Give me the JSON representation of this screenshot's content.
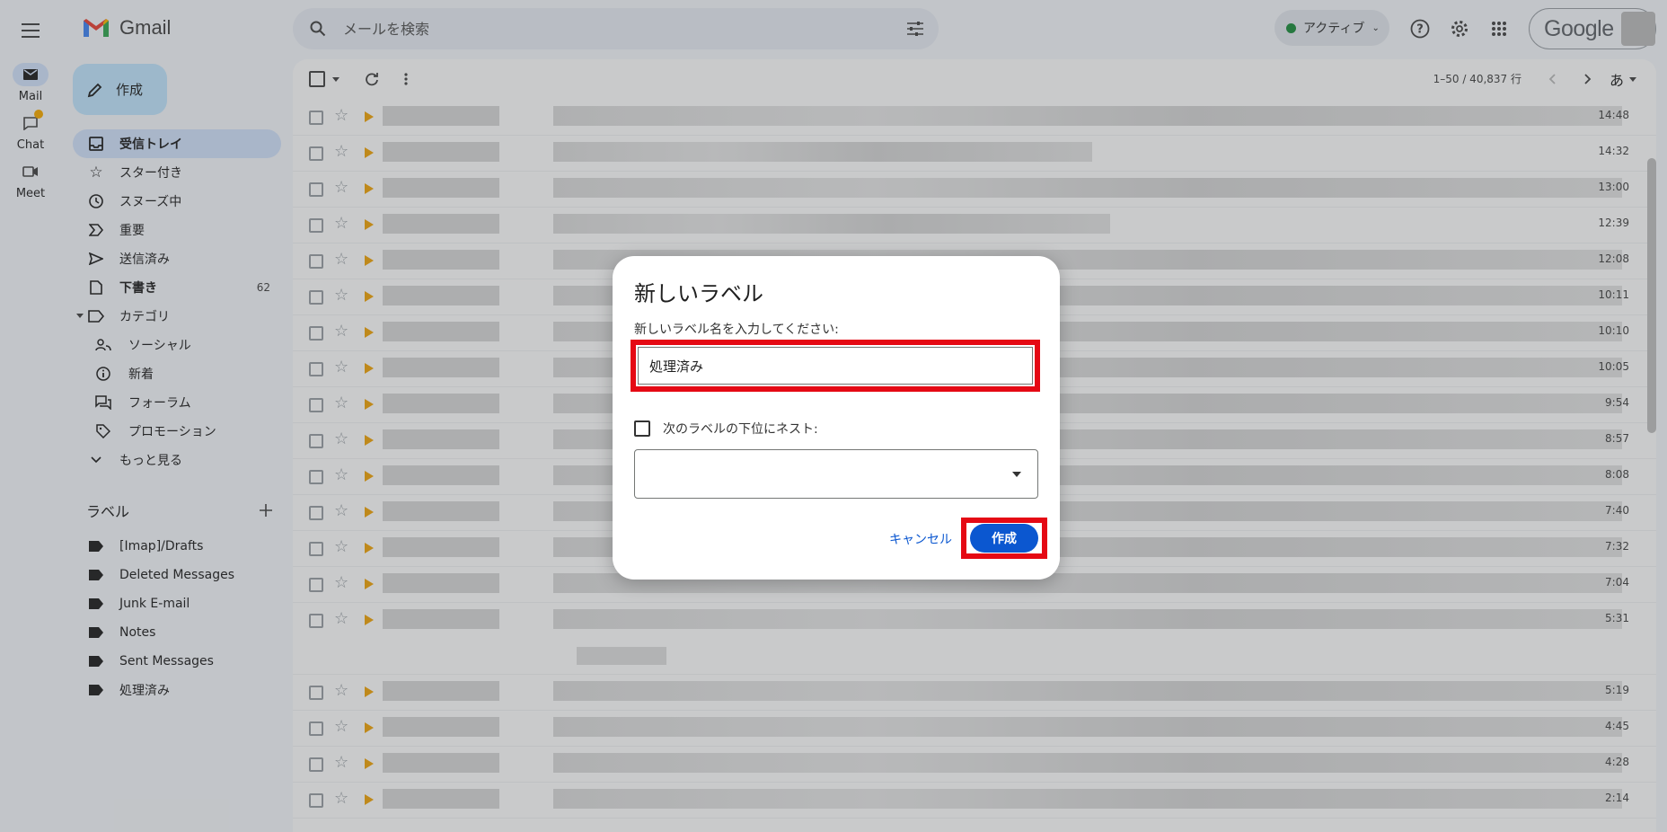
{
  "app": {
    "name": "Gmail"
  },
  "rail": [
    {
      "label": "Mail",
      "icon": "mail-icon",
      "active": true
    },
    {
      "label": "Chat",
      "icon": "chat-icon"
    },
    {
      "label": "Meet",
      "icon": "meet-icon"
    }
  ],
  "search": {
    "placeholder": "メールを検索"
  },
  "status": {
    "label": "アクティブ"
  },
  "account": {
    "brand": "Google"
  },
  "compose": {
    "label": "作成"
  },
  "nav": [
    {
      "label": "受信トレイ",
      "icon": "inbox-icon",
      "active": true
    },
    {
      "label": "スター付き",
      "icon": "star-icon"
    },
    {
      "label": "スヌーズ中",
      "icon": "clock-icon"
    },
    {
      "label": "重要",
      "icon": "important-icon"
    },
    {
      "label": "送信済み",
      "icon": "send-icon"
    },
    {
      "label": "下書き",
      "icon": "draft-icon",
      "count": "62"
    },
    {
      "label": "カテゴリ",
      "icon": "category-icon"
    },
    {
      "label": "ソーシャル",
      "icon": "people-icon",
      "sub": true
    },
    {
      "label": "新着",
      "icon": "info-icon",
      "sub": true
    },
    {
      "label": "フォーラム",
      "icon": "forum-icon",
      "sub": true
    },
    {
      "label": "プロモーション",
      "icon": "tag-icon",
      "sub": true
    },
    {
      "label": "もっと見る",
      "icon": "chevron-down-icon"
    }
  ],
  "labels_header": "ラベル",
  "labels": [
    "[Imap]/Drafts",
    "Deleted Messages",
    "Junk E-mail",
    "Notes",
    "Sent Messages",
    "処理済み"
  ],
  "toolbar": {
    "pagination": "1–50 / 40,837 行",
    "lang": "あ"
  },
  "emails": [
    {
      "time": "14:48"
    },
    {
      "time": "14:32"
    },
    {
      "time": "13:00"
    },
    {
      "time": "12:39"
    },
    {
      "time": "12:08"
    },
    {
      "time": "10:11"
    },
    {
      "time": "10:10"
    },
    {
      "time": "10:05"
    },
    {
      "time": "9:54"
    },
    {
      "time": "8:57"
    },
    {
      "time": "8:08"
    },
    {
      "time": "7:40"
    },
    {
      "time": "7:32"
    },
    {
      "time": "7:04"
    },
    {
      "time": "5:31"
    },
    {
      "time": "5:19"
    },
    {
      "time": "4:45"
    },
    {
      "time": "4:28"
    },
    {
      "time": "2:14"
    }
  ],
  "dialog": {
    "title": "新しいラベル",
    "prompt": "新しいラベル名を入力してください:",
    "input_value": "処理済み",
    "nest_label": "次のラベルの下位にネスト:",
    "cancel": "キャンセル",
    "create": "作成"
  },
  "colors": {
    "accent": "#0b57d0",
    "highlight": "#e50914",
    "compose_bg": "#c2e7ff",
    "nav_active": "#d3e3fd"
  }
}
